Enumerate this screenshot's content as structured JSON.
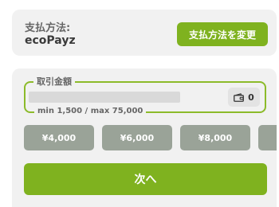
{
  "payment_method": {
    "label": "支払方法:",
    "value": "ecoPayz",
    "change_button": "支払方法を変更"
  },
  "amount": {
    "legend": "取引金額",
    "balance_icon": "wallet-icon",
    "balance_value": "0",
    "limits": "min 1,500 / max 75,000",
    "presets": [
      "¥4,000",
      "¥6,000",
      "¥8,000"
    ]
  },
  "next_button": "次へ",
  "colors": {
    "accent": "#7fb21f",
    "preset_bg": "#9aa398",
    "panel_bg": "#f1f1f1"
  }
}
